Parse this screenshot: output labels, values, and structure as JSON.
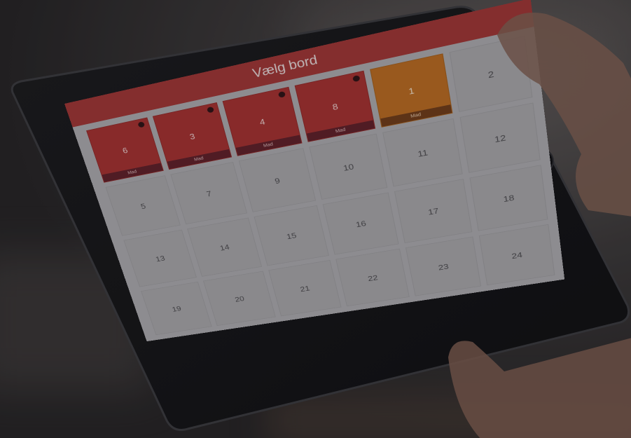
{
  "app": {
    "title": "Vælg bord"
  },
  "colors": {
    "header": "#9e3534",
    "busy_table": "#a3302f",
    "selected_table": "#b76a20",
    "free_table": "#a5a4a7"
  },
  "tables": [
    {
      "number": "6",
      "status": "busy",
      "label": "Mad",
      "indicator": true
    },
    {
      "number": "3",
      "status": "busy",
      "label": "Mad",
      "indicator": true
    },
    {
      "number": "4",
      "status": "busy",
      "label": "Mad",
      "indicator": true
    },
    {
      "number": "8",
      "status": "busy",
      "label": "Mad",
      "indicator": true
    },
    {
      "number": "1",
      "status": "selected",
      "label": "Mad",
      "indicator": false
    },
    {
      "number": "2",
      "status": "free"
    },
    {
      "number": "5",
      "status": "free"
    },
    {
      "number": "7",
      "status": "free"
    },
    {
      "number": "9",
      "status": "free"
    },
    {
      "number": "10",
      "status": "free"
    },
    {
      "number": "11",
      "status": "free"
    },
    {
      "number": "12",
      "status": "free"
    },
    {
      "number": "13",
      "status": "free"
    },
    {
      "number": "14",
      "status": "free"
    },
    {
      "number": "15",
      "status": "free"
    },
    {
      "number": "16",
      "status": "free"
    },
    {
      "number": "17",
      "status": "free"
    },
    {
      "number": "18",
      "status": "free"
    },
    {
      "number": "19",
      "status": "free"
    },
    {
      "number": "20",
      "status": "free"
    },
    {
      "number": "21",
      "status": "free"
    },
    {
      "number": "22",
      "status": "free"
    },
    {
      "number": "23",
      "status": "free"
    },
    {
      "number": "24",
      "status": "free"
    }
  ]
}
